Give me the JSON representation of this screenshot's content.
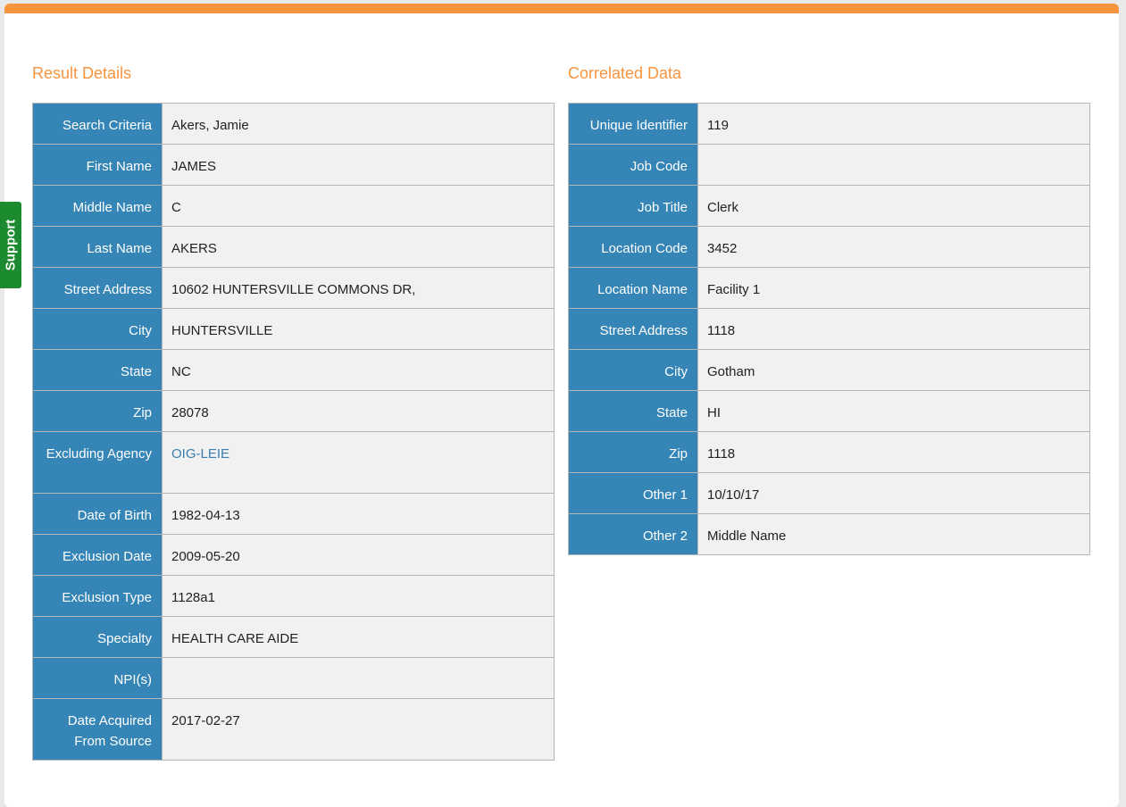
{
  "result_details": {
    "title": "Result Details",
    "rows": [
      {
        "label": "Search Criteria",
        "value": "Akers, Jamie"
      },
      {
        "label": "First Name",
        "value": "JAMES"
      },
      {
        "label": "Middle Name",
        "value": "C"
      },
      {
        "label": "Last Name",
        "value": "AKERS"
      },
      {
        "label": "Street Address",
        "value": "10602 HUNTERSVILLE COMMONS DR,"
      },
      {
        "label": "City",
        "value": "HUNTERSVILLE"
      },
      {
        "label": "State",
        "value": "NC"
      },
      {
        "label": "Zip",
        "value": "28078"
      },
      {
        "label": "Excluding Agency",
        "value": "OIG-LEIE"
      },
      {
        "label": "Date of Birth",
        "value": "1982-04-13"
      },
      {
        "label": "Exclusion Date",
        "value": "2009-05-20"
      },
      {
        "label": "Exclusion Type",
        "value": "1128a1"
      },
      {
        "label": "Specialty",
        "value": "HEALTH CARE AIDE"
      },
      {
        "label": "NPI(s)",
        "value": ""
      },
      {
        "label": "Date Acquired From Source",
        "value": "2017-02-27"
      }
    ]
  },
  "correlated_data": {
    "title": "Correlated Data",
    "rows": [
      {
        "label": "Unique Identifier",
        "value": "119"
      },
      {
        "label": "Job Code",
        "value": ""
      },
      {
        "label": "Job Title",
        "value": "Clerk"
      },
      {
        "label": "Location Code",
        "value": "3452"
      },
      {
        "label": "Location Name",
        "value": "Facility 1"
      },
      {
        "label": "Street Address",
        "value": "1118"
      },
      {
        "label": "City",
        "value": "Gotham"
      },
      {
        "label": "State",
        "value": "HI"
      },
      {
        "label": "Zip",
        "value": "1118"
      },
      {
        "label": "Other 1",
        "value": "10/10/17"
      },
      {
        "label": "Other 2",
        "value": "Middle Name"
      }
    ]
  },
  "support_tab": {
    "label": "Support"
  },
  "colors": {
    "accent": "#f7943d",
    "label_bg": "#3585b6",
    "value_bg": "#f1f1f1",
    "link": "#3a7fb0",
    "support_bg": "#1c8a2e"
  }
}
